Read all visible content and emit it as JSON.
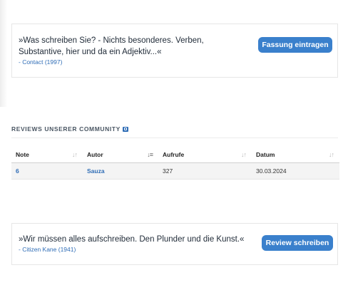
{
  "quote_top": {
    "text": "»Was schreiben Sie? - Nichts besonderes. Verben, Substantive, hier und da ein Adjektiv...«",
    "source": "- Contact (1997)",
    "button_label": "Fassung eintragen"
  },
  "community_reviews": {
    "heading": "REVIEWS UNSERER COMMUNITY",
    "columns": [
      {
        "label": "Note",
        "sort_icon": "sort-icon"
      },
      {
        "label": "Autor",
        "sort_icon": "sort-alpha-icon"
      },
      {
        "label": "Aufrufe",
        "sort_icon": "sort-icon"
      },
      {
        "label": "Datum",
        "sort_icon": "sort-icon"
      }
    ],
    "rows": [
      {
        "note": "6",
        "autor": "Sauza",
        "aufrufe": "327",
        "datum": "30.03.2024"
      }
    ]
  },
  "quote_bottom": {
    "text": "»Wir müssen alles aufschreiben. Den Plunder und die Kunst.«",
    "source": "- Citizen Kane (1941)",
    "button_label": "Review schreiben"
  },
  "colors": {
    "accent": "#3a80cc",
    "link": "#2f6db6",
    "row_background": "#f4f4f4"
  }
}
